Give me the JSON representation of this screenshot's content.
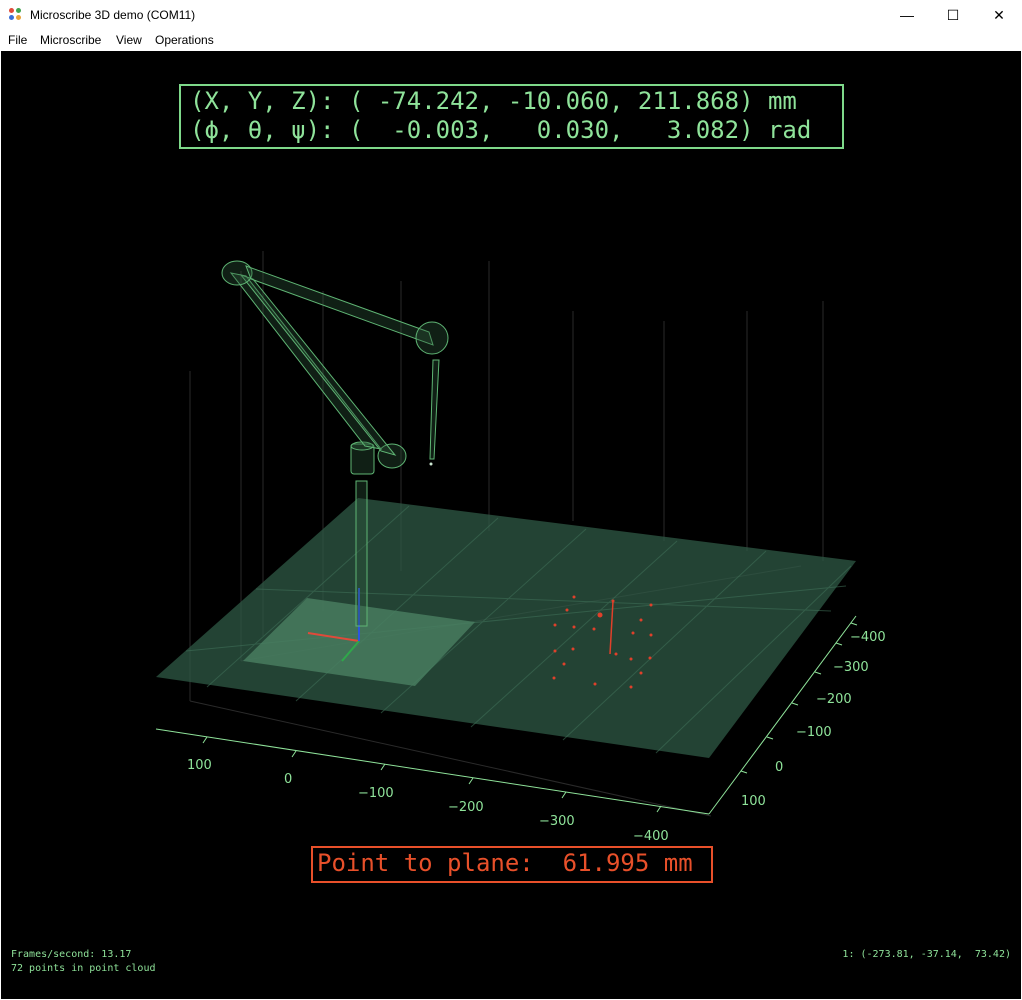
{
  "window": {
    "title": "Microscribe 3D demo (COM11)",
    "controls": {
      "minimize": "—",
      "maximize": "☐",
      "close": "✕"
    }
  },
  "menu": [
    "File",
    "Microscribe",
    "View",
    "Operations"
  ],
  "readout": {
    "xyz": "(X, Y, Z): ( -74.242, -10.060, 211.868) mm",
    "angles": "(ϕ, θ, ψ): (  -0.003,   0.030,   3.082) rad"
  },
  "point_to_plane": "Point to plane:  61.995 mm",
  "axes": {
    "x_ticks": [
      "100",
      "0",
      "−100",
      "−200",
      "−300",
      "−400"
    ],
    "y_ticks": [
      "−400",
      "−300",
      "−200",
      "−100",
      "0",
      "100"
    ]
  },
  "status": {
    "fps": "Frames/second: 13.17",
    "points": "72 points in point cloud",
    "last_point": "1: (-273.81, -37.14,  73.42)"
  },
  "colors": {
    "accent_green": "#8fe39a",
    "plane_fill": "#2f5a45",
    "point_red": "#e0402a"
  },
  "icons": [
    "app-icon",
    "minimize-icon",
    "maximize-icon",
    "close-icon"
  ]
}
